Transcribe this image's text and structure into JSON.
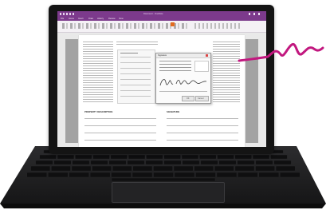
{
  "image": {
    "device": "tablet-with-keyboard",
    "app": "OneNote",
    "accent_color": "#7c3a8c",
    "ink_color": "#c2187f",
    "keyboard_color": "#1e1e1f",
    "bezel_color": "#141414"
  },
  "window": {
    "title": "Document - OneNote",
    "ribbon_tabs": [
      "File",
      "Home",
      "Insert",
      "Draw",
      "History",
      "Review",
      "View"
    ]
  },
  "page": {
    "section_heading_left": "PROPERTY DESCRIPTION",
    "section_heading_right": "SIGNATURE"
  },
  "dialog": {
    "title": "Signature",
    "ok_label": "OK",
    "cancel_label": "Cancel"
  }
}
